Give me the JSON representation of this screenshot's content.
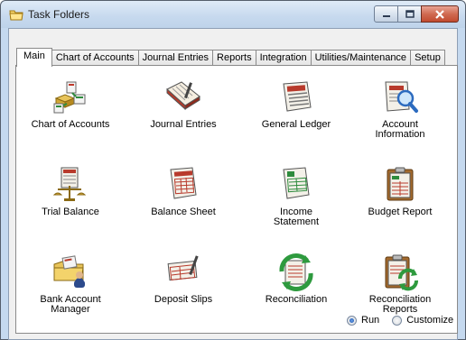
{
  "window": {
    "title": "Task Folders"
  },
  "tabs": [
    {
      "label": "Main",
      "active": true
    },
    {
      "label": "Chart of Accounts",
      "active": false
    },
    {
      "label": "Journal Entries",
      "active": false
    },
    {
      "label": "Reports",
      "active": false
    },
    {
      "label": "Integration",
      "active": false
    },
    {
      "label": "Utilities/Maintenance",
      "active": false
    },
    {
      "label": "Setup",
      "active": false
    }
  ],
  "items": [
    {
      "label": "Chart of Accounts",
      "icon": "chart-of-accounts-icon"
    },
    {
      "label": "Journal Entries",
      "icon": "journal-entries-icon"
    },
    {
      "label": "General Ledger",
      "icon": "general-ledger-icon"
    },
    {
      "label": "Account Information",
      "icon": "account-information-icon"
    },
    {
      "label": "Trial Balance",
      "icon": "trial-balance-icon"
    },
    {
      "label": "Balance Sheet",
      "icon": "balance-sheet-icon"
    },
    {
      "label": "Income Statement",
      "icon": "income-statement-icon"
    },
    {
      "label": "Budget Report",
      "icon": "budget-report-icon"
    },
    {
      "label": "Bank Account Manager",
      "icon": "bank-account-manager-icon"
    },
    {
      "label": "Deposit Slips",
      "icon": "deposit-slips-icon"
    },
    {
      "label": "Reconciliation",
      "icon": "reconciliation-icon"
    },
    {
      "label": "Reconciliation Reports",
      "icon": "reconciliation-reports-icon"
    }
  ],
  "mode": {
    "run_label": "Run",
    "customize_label": "Customize",
    "selected": "Run"
  }
}
